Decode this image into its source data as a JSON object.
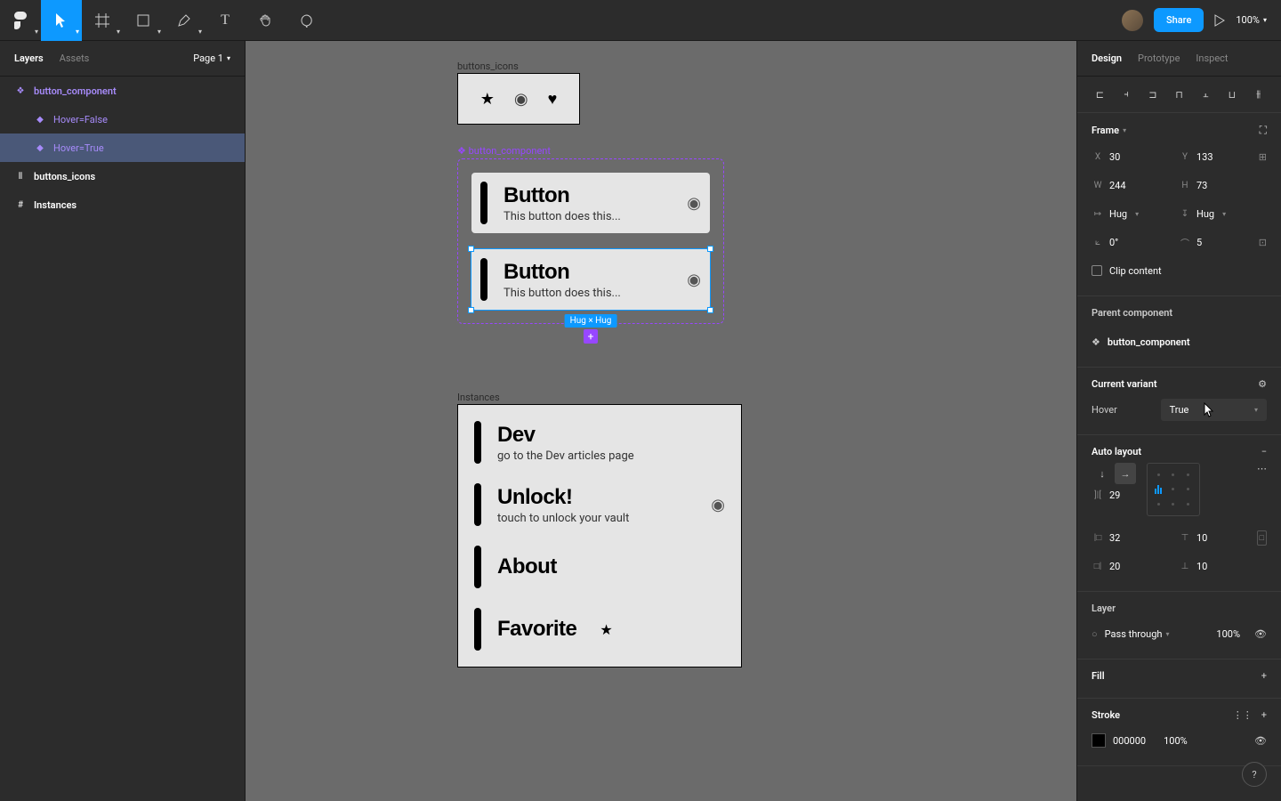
{
  "toolbar": {
    "share_label": "Share",
    "zoom": "100%"
  },
  "left_panel": {
    "tabs": [
      "Layers",
      "Assets"
    ],
    "page": "Page 1",
    "layers": [
      {
        "type": "component",
        "name": "button_component"
      },
      {
        "type": "variant",
        "name": "Hover=False"
      },
      {
        "type": "variant",
        "name": "Hover=True",
        "selected": true
      },
      {
        "type": "frame",
        "name": "buttons_icons"
      },
      {
        "type": "frame",
        "name": "Instances"
      }
    ]
  },
  "canvas": {
    "icons_label": "buttons_icons",
    "component_label": "button_component",
    "instances_label": "Instances",
    "button_title": "Button",
    "button_sub": "This button does this...",
    "hug_badge": "Hug × Hug",
    "instances": [
      {
        "title": "Dev",
        "sub": "go to the Dev articles page",
        "icon": null
      },
      {
        "title": "Unlock!",
        "sub": "touch to unlock your vault",
        "icon": "fingerprint"
      },
      {
        "title": "About",
        "sub": null,
        "icon": null
      },
      {
        "title": "Favorite",
        "sub": null,
        "icon": "star"
      }
    ]
  },
  "right_panel": {
    "tabs": [
      "Design",
      "Prototype",
      "Inspect"
    ],
    "frame_title": "Frame",
    "x": "30",
    "y": "133",
    "w": "244",
    "h": "73",
    "resize_h": "Hug",
    "resize_v": "Hug",
    "rotation": "0°",
    "radius": "5",
    "clip_content": "Clip content",
    "parent_title": "Parent component",
    "parent_name": "button_component",
    "variant_title": "Current variant",
    "variant_prop": "Hover",
    "variant_value": "True",
    "autolayout_title": "Auto layout",
    "spacing": "29",
    "pad_left": "32",
    "pad_top": "10",
    "pad_right": "20",
    "pad_bottom": "10",
    "layer_title": "Layer",
    "blend_mode": "Pass through",
    "opacity": "100%",
    "fill_title": "Fill",
    "stroke_title": "Stroke",
    "stroke_color": "000000",
    "stroke_opacity": "100%"
  }
}
